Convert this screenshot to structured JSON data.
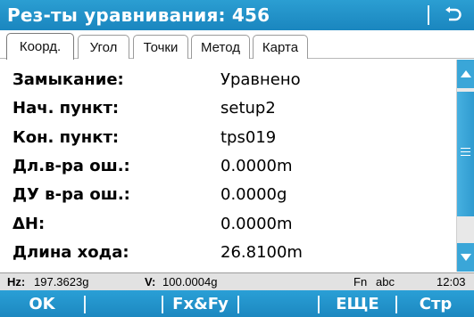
{
  "title": "Рез-ты уравнивания: 456",
  "tabs": [
    {
      "label": "Коорд."
    },
    {
      "label": "Угол"
    },
    {
      "label": "Точки"
    },
    {
      "label": "Метод"
    },
    {
      "label": "Карта"
    }
  ],
  "rows": [
    {
      "label": "Замыкание:",
      "value": "Уравнено"
    },
    {
      "label": "Нач. пункт:",
      "value": "setup2"
    },
    {
      "label": "Кон. пункт:",
      "value": "tps019"
    },
    {
      "label": "Дл.в-ра ош.:",
      "value": "0.0000m"
    },
    {
      "label": "ДУ в-ра ош.:",
      "value": "0.0000g"
    },
    {
      "label": "ΔН:",
      "value": "0.0000m"
    },
    {
      "label": "Длина хода:",
      "value": "26.8100m"
    }
  ],
  "status": {
    "hz_label": "Hz:",
    "hz_value": "197.3623g",
    "v_label": "V:",
    "v_value": "100.0004g",
    "mode": "Fn",
    "input": "abc",
    "time": "12:03"
  },
  "fkeys": {
    "f1": "OK",
    "f2": "",
    "f3": "Fx&Fy",
    "f4": "",
    "f5": "ЕЩЕ",
    "f6": "Стр"
  },
  "icons": {
    "back": "return-arrow-icon",
    "scroll_up": "arrow-up-icon",
    "scroll_down": "arrow-down-icon"
  },
  "colors": {
    "accent": "#1c8fc8",
    "statusbar": "#e2e2e2"
  }
}
